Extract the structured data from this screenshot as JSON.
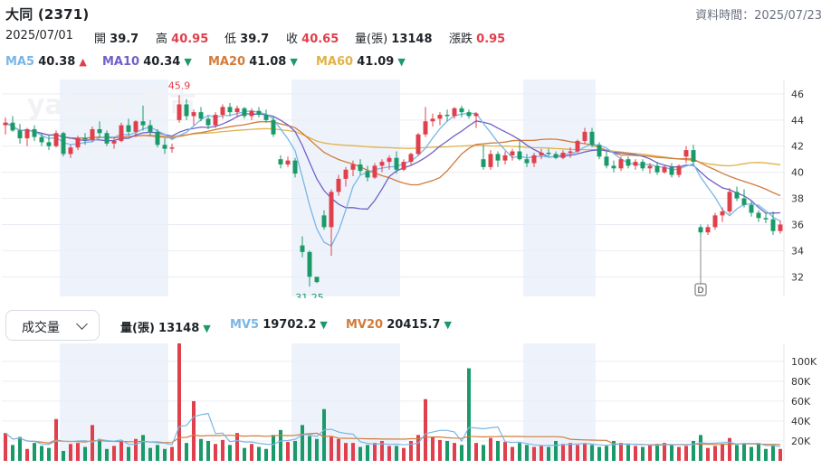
{
  "header": {
    "title": "大同 (2371)",
    "timestamp": "資料時間：2025/07/23"
  },
  "ohlc": {
    "date": "2025/07/01",
    "open_label": "開",
    "open": "39.7",
    "high_label": "高",
    "high": "40.95",
    "low_label": "低",
    "low": "39.7",
    "close_label": "收",
    "close": "40.65",
    "volume_label": "量(張)",
    "volume": "13148",
    "change_label": "漲跌",
    "change": "0.95"
  },
  "moving_averages": [
    {
      "name": "MA5",
      "value": "40.38",
      "direction": "up",
      "color": "#7ab6e6"
    },
    {
      "name": "MA10",
      "value": "40.34",
      "direction": "down",
      "color": "#6f61c9"
    },
    {
      "name": "MA20",
      "value": "41.08",
      "direction": "down",
      "color": "#d27b3a"
    },
    {
      "name": "MA60",
      "value": "41.09",
      "direction": "down",
      "color": "#e1b247"
    }
  ],
  "watermark": {
    "text": "yahoo! 股市"
  },
  "volume_header": {
    "selector_label": "成交量",
    "volume_label": "量(張)",
    "volume": "13148",
    "mv5_label": "MV5",
    "mv5": "19702.2",
    "mv20_label": "MV20",
    "mv20": "20415.7",
    "mv5_color": "#7ab6e6",
    "mv20_color": "#d27b3a"
  },
  "chart_data": [
    {
      "type": "candlestick",
      "y_ticks": [
        "46",
        "44",
        "42",
        "40",
        "38",
        "36",
        "34",
        "32"
      ],
      "ylim": [
        30.5,
        47.1
      ],
      "annotations": [
        {
          "text": "45.9",
          "value": 45.9,
          "kind": "high"
        },
        {
          "text": "31.25",
          "value": 31.25,
          "kind": "low"
        },
        {
          "text": "D",
          "kind": "marker"
        }
      ],
      "shaded_periods": [
        [
          8,
          23
        ],
        [
          40,
          55
        ],
        [
          72,
          82
        ]
      ],
      "candles": [
        [
          43.6,
          44.2,
          42.9,
          43.8
        ],
        [
          43.8,
          44.3,
          43.1,
          43.2
        ],
        [
          43.2,
          43.7,
          42.2,
          42.6
        ],
        [
          42.6,
          43.4,
          42.0,
          43.3
        ],
        [
          43.3,
          43.6,
          42.4,
          42.7
        ],
        [
          42.7,
          43.0,
          42.0,
          42.3
        ],
        [
          42.3,
          42.8,
          41.7,
          42.0
        ],
        [
          42.0,
          43.2,
          41.9,
          43.0
        ],
        [
          43.0,
          43.1,
          41.2,
          41.4
        ],
        [
          41.4,
          42.1,
          41.1,
          41.9
        ],
        [
          41.9,
          42.8,
          41.7,
          42.6
        ],
        [
          42.6,
          43.0,
          42.1,
          42.5
        ],
        [
          42.5,
          43.5,
          42.3,
          43.3
        ],
        [
          43.3,
          43.9,
          42.6,
          43.0
        ],
        [
          43.0,
          43.2,
          42.0,
          42.2
        ],
        [
          42.2,
          42.7,
          41.8,
          42.4
        ],
        [
          42.4,
          43.8,
          42.3,
          43.6
        ],
        [
          43.6,
          44.1,
          42.8,
          43.1
        ],
        [
          43.1,
          44.0,
          42.7,
          43.9
        ],
        [
          43.9,
          45.1,
          43.2,
          43.6
        ],
        [
          43.6,
          44.0,
          42.8,
          43.1
        ],
        [
          43.1,
          43.3,
          41.9,
          42.1
        ],
        [
          42.1,
          42.6,
          41.4,
          41.8
        ],
        [
          41.8,
          42.2,
          41.5,
          41.9
        ],
        [
          44.0,
          45.9,
          43.8,
          45.2
        ],
        [
          45.2,
          45.6,
          44.0,
          44.3
        ],
        [
          44.3,
          44.8,
          43.6,
          44.6
        ],
        [
          44.6,
          45.0,
          43.9,
          44.1
        ],
        [
          44.1,
          44.3,
          43.3,
          43.6
        ],
        [
          43.6,
          44.6,
          43.4,
          44.4
        ],
        [
          44.4,
          45.2,
          44.1,
          45.0
        ],
        [
          45.0,
          45.3,
          44.3,
          44.6
        ],
        [
          44.6,
          45.1,
          44.2,
          44.9
        ],
        [
          44.9,
          45.0,
          44.1,
          44.3
        ],
        [
          44.3,
          44.9,
          44.0,
          44.7
        ],
        [
          44.7,
          45.0,
          44.2,
          44.4
        ],
        [
          44.4,
          44.8,
          43.8,
          44.0
        ],
        [
          44.0,
          44.3,
          42.7,
          42.9
        ],
        [
          41.0,
          41.3,
          40.3,
          40.6
        ],
        [
          40.6,
          41.2,
          40.4,
          40.9
        ],
        [
          40.9,
          41.1,
          39.6,
          39.9
        ],
        [
          34.4,
          35.1,
          33.5,
          33.9
        ],
        [
          33.9,
          34.0,
          31.25,
          32.0
        ],
        [
          32.0,
          32.0,
          31.5,
          31.6
        ],
        [
          36.7,
          37.1,
          35.6,
          35.8
        ],
        [
          35.8,
          38.7,
          33.6,
          38.5
        ],
        [
          38.5,
          39.8,
          38.2,
          39.5
        ],
        [
          39.5,
          40.4,
          38.9,
          40.2
        ],
        [
          40.2,
          40.9,
          39.7,
          40.6
        ],
        [
          40.6,
          41.0,
          39.8,
          40.1
        ],
        [
          40.1,
          40.5,
          39.3,
          39.6
        ],
        [
          39.6,
          40.7,
          39.5,
          40.5
        ],
        [
          40.5,
          41.0,
          40.0,
          40.8
        ],
        [
          40.8,
          41.3,
          40.2,
          41.1
        ],
        [
          41.1,
          41.6,
          39.9,
          40.2
        ],
        [
          40.2,
          41.0,
          40.1,
          40.8
        ],
        [
          40.8,
          41.5,
          40.6,
          41.4
        ],
        [
          41.4,
          43.0,
          41.3,
          42.9
        ],
        [
          42.9,
          45.0,
          42.7,
          43.9
        ],
        [
          43.9,
          44.5,
          43.5,
          44.1
        ],
        [
          44.1,
          44.6,
          43.6,
          44.4
        ],
        [
          44.4,
          44.8,
          43.9,
          44.3
        ],
        [
          44.3,
          45.0,
          44.1,
          44.9
        ],
        [
          44.9,
          45.1,
          44.2,
          44.6
        ],
        [
          44.6,
          44.8,
          44.1,
          44.3
        ],
        [
          44.3,
          44.6,
          43.4,
          44.5
        ],
        [
          41.0,
          42.1,
          40.2,
          40.4
        ],
        [
          40.4,
          41.7,
          40.2,
          41.4
        ],
        [
          41.4,
          41.6,
          40.4,
          40.9
        ],
        [
          40.9,
          41.6,
          40.6,
          41.3
        ],
        [
          41.3,
          41.8,
          40.9,
          41.6
        ],
        [
          41.6,
          42.4,
          40.9,
          41.0
        ],
        [
          41.0,
          41.4,
          40.4,
          40.7
        ],
        [
          40.7,
          41.5,
          40.4,
          41.3
        ],
        [
          41.3,
          41.8,
          41.0,
          41.5
        ],
        [
          41.5,
          41.8,
          41.2,
          41.4
        ],
        [
          41.4,
          41.6,
          41.0,
          41.1
        ],
        [
          41.1,
          41.7,
          41.0,
          41.5
        ],
        [
          41.5,
          41.9,
          41.1,
          41.6
        ],
        [
          41.6,
          42.5,
          41.5,
          42.4
        ],
        [
          42.4,
          43.4,
          42.2,
          43.1
        ],
        [
          43.1,
          43.4,
          41.9,
          42.1
        ],
        [
          42.1,
          42.3,
          41.0,
          41.2
        ],
        [
          41.2,
          41.6,
          40.3,
          40.5
        ],
        [
          40.5,
          40.9,
          40.0,
          40.3
        ],
        [
          40.3,
          41.2,
          40.1,
          41.0
        ],
        [
          41.0,
          41.2,
          40.3,
          40.5
        ],
        [
          40.5,
          41.0,
          40.2,
          40.8
        ],
        [
          40.8,
          41.0,
          40.1,
          40.3
        ],
        [
          40.3,
          40.7,
          39.9,
          40.5
        ],
        [
          40.5,
          40.8,
          39.8,
          40.0
        ],
        [
          40.0,
          40.6,
          39.9,
          40.4
        ],
        [
          40.4,
          40.7,
          39.6,
          39.8
        ],
        [
          39.8,
          40.6,
          39.6,
          40.5
        ],
        [
          41.2,
          42.0,
          40.7,
          41.7
        ],
        [
          41.7,
          42.1,
          40.6,
          40.8
        ],
        [
          35.8,
          36.0,
          35.2,
          35.4
        ],
        [
          35.4,
          36.0,
          35.2,
          35.8
        ],
        [
          35.8,
          36.9,
          35.6,
          36.7
        ],
        [
          36.7,
          37.3,
          36.2,
          37.0
        ],
        [
          37.0,
          38.8,
          36.8,
          38.5
        ],
        [
          38.5,
          38.9,
          37.8,
          38.0
        ],
        [
          38.0,
          38.7,
          37.3,
          37.5
        ],
        [
          37.5,
          37.8,
          36.6,
          36.9
        ],
        [
          36.9,
          37.1,
          36.2,
          36.5
        ],
        [
          36.5,
          36.9,
          36.1,
          36.4
        ],
        [
          36.4,
          37.0,
          35.2,
          35.5
        ],
        [
          35.5,
          36.3,
          35.3,
          36.0
        ]
      ]
    },
    {
      "type": "volume_bar",
      "y_ticks": [
        "100K",
        "80K",
        "60K",
        "40K",
        "20K"
      ],
      "ylim": [
        0,
        118000
      ],
      "values": [
        28000,
        16000,
        24000,
        12000,
        18000,
        15000,
        13000,
        42000,
        10000,
        17000,
        18000,
        14000,
        36000,
        22000,
        12000,
        15000,
        20000,
        14000,
        22000,
        26000,
        13000,
        16000,
        12000,
        14000,
        118000,
        18000,
        60000,
        22000,
        20000,
        17000,
        21000,
        16000,
        28000,
        13000,
        17000,
        14000,
        12000,
        26000,
        31000,
        19000,
        20000,
        36000,
        25000,
        22000,
        52000,
        24000,
        22000,
        18000,
        18000,
        14000,
        16000,
        18000,
        20000,
        15000,
        15000,
        13000,
        20000,
        26000,
        62000,
        24000,
        21000,
        20000,
        18000,
        16000,
        93000,
        18000,
        16000,
        23000,
        20000,
        19000,
        14000,
        18000,
        16000,
        14000,
        15000,
        14000,
        20000,
        17000,
        18000,
        16000,
        17000,
        16000,
        14000,
        15000,
        20000,
        18000,
        16000,
        15000,
        14000,
        16000,
        17000,
        18000,
        16000,
        14000,
        15000,
        20000,
        26000,
        13000,
        15000,
        17000,
        23000,
        16000,
        17000,
        14000,
        18000,
        12000,
        16000,
        12000
      ],
      "legend": [
        {
          "name": "MV5",
          "color": "#7ab6e6"
        },
        {
          "name": "MV20",
          "color": "#d27b3a"
        }
      ]
    }
  ]
}
